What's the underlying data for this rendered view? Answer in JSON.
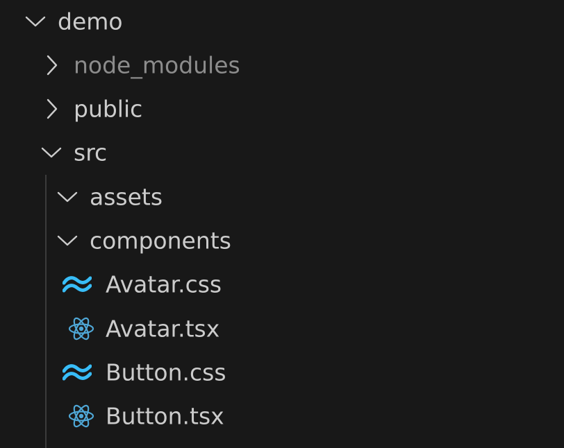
{
  "explorer": {
    "root": {
      "label": "demo"
    },
    "items": [
      {
        "label": "node_modules"
      },
      {
        "label": "public"
      },
      {
        "label": "src"
      },
      {
        "label": "assets"
      },
      {
        "label": "components"
      },
      {
        "label": "Avatar.css"
      },
      {
        "label": "Avatar.tsx"
      },
      {
        "label": "Button.css"
      },
      {
        "label": "Button.tsx"
      }
    ]
  },
  "icons": {
    "chevron_expanded": "chevron-down-icon",
    "chevron_collapsed": "chevron-right-icon",
    "css_file": "tailwind-icon",
    "tsx_file": "react-icon"
  },
  "colors": {
    "background": "#181818",
    "text": "#cccccc",
    "ignored_text": "#8c8c8c",
    "tailwind_blue": "#38bdf8",
    "react_blue": "#4fa7d6",
    "indent_guide": "#3c3c3c"
  }
}
